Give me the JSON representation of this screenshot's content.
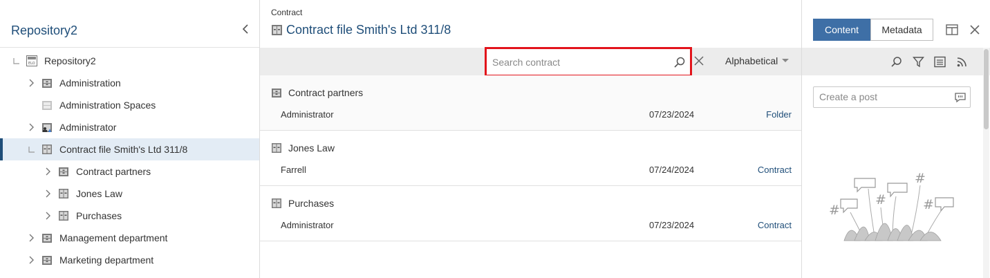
{
  "repository": {
    "title": "Repository2",
    "tree": [
      {
        "label": "Repository2",
        "icon": "repository-icon",
        "expander": "collapse",
        "level": 0
      },
      {
        "label": "Administration",
        "icon": "folder-icon",
        "expander": "expand",
        "level": 1
      },
      {
        "label": "Administration Spaces",
        "icon": "folder-disabled-icon",
        "expander": "none",
        "level": 1
      },
      {
        "label": "Administrator",
        "icon": "user-folder-icon",
        "expander": "expand",
        "level": 1
      },
      {
        "label": "Contract file Smith's Ltd 311/8",
        "icon": "file-cabinet-icon",
        "expander": "collapse",
        "level": 1,
        "selected": true
      },
      {
        "label": "Contract partners",
        "icon": "folder-icon",
        "expander": "expand",
        "level": 2
      },
      {
        "label": "Jones Law",
        "icon": "file-cabinet-icon",
        "expander": "expand",
        "level": 2
      },
      {
        "label": "Purchases",
        "icon": "file-cabinet-icon",
        "expander": "expand",
        "level": 2
      },
      {
        "label": "Management department",
        "icon": "folder-icon",
        "expander": "expand",
        "level": 1
      },
      {
        "label": "Marketing department",
        "icon": "folder-icon",
        "expander": "expand",
        "level": 1
      }
    ]
  },
  "document": {
    "breadcrumb": "Contract",
    "title": "Contract file Smith's Ltd 311/8",
    "icon": "file-cabinet-icon"
  },
  "toolbar": {
    "search_placeholder": "Search contract",
    "search_value": "",
    "sort_label": "Alphabetical",
    "highlight_color": "#e2141b"
  },
  "items": [
    {
      "name": "Contract partners",
      "owner": "Administrator",
      "date": "07/23/2024",
      "type": "Folder",
      "icon": "folder-icon"
    },
    {
      "name": "Jones Law",
      "owner": "Farrell",
      "date": "07/24/2024",
      "type": "Contract",
      "icon": "file-cabinet-icon"
    },
    {
      "name": "Purchases",
      "owner": "Administrator",
      "date": "07/23/2024",
      "type": "Contract",
      "icon": "file-cabinet-icon"
    }
  ],
  "right_panel": {
    "tabs": [
      {
        "label": "Content",
        "active": true
      },
      {
        "label": "Metadata",
        "active": false
      }
    ],
    "tools": [
      "search-icon",
      "filter-icon",
      "list-icon",
      "feed-icon"
    ],
    "post_placeholder": "Create a post"
  },
  "colors": {
    "accent": "#1f4e79",
    "tab_active": "#3e6fa6",
    "selected_row": "#e3ecf5"
  }
}
